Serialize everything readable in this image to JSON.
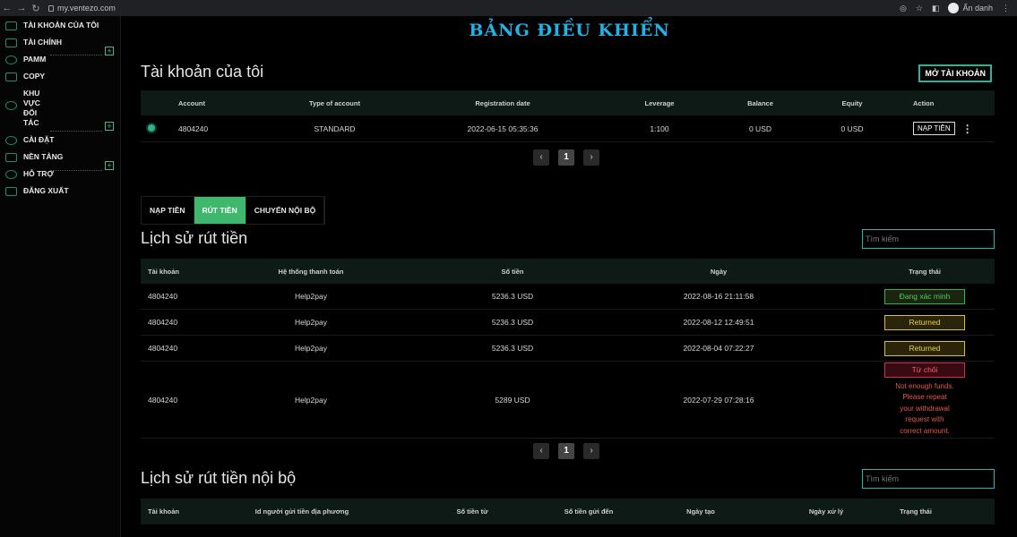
{
  "browser": {
    "url": "my.ventezo.com",
    "profile_label": "Ẩn danh"
  },
  "sidebar": {
    "items": [
      {
        "label": "TÀI KHOẢN CỦA TÔI"
      },
      {
        "label": "TÀI CHÍNH",
        "expandable": true
      },
      {
        "label": "PAMM"
      },
      {
        "label": "COPY"
      },
      {
        "label": "KHU VỰC ĐỐI TÁC",
        "expandable": true
      },
      {
        "label": "CÀI ĐẶT",
        "expandable": true
      },
      {
        "label": "NỀN TẢNG"
      },
      {
        "label": "HỖ TRỢ"
      },
      {
        "label": "ĐĂNG XUẤT"
      }
    ]
  },
  "main": {
    "dashboard_title": "BẢNG ĐIỀU KHIỂN",
    "accounts": {
      "title": "Tài khoản của tôi",
      "open_button": "MỞ TÀI KHOẢN",
      "columns": [
        "Account",
        "Type of account",
        "Registration date",
        "Leverage",
        "Balance",
        "Equity",
        "Action"
      ],
      "rows": [
        {
          "account": "4804240",
          "type": "STANDARD",
          "date": "2022-06-15 05:35:36",
          "leverage": "1:100",
          "balance": "0 USD",
          "equity": "0 USD",
          "action": "NẠP TIỀN"
        }
      ],
      "page": "1"
    },
    "tabs": [
      "NẠP TIỀN",
      "RÚT TIỀN",
      "CHUYỂN NỘI BỘ"
    ],
    "active_tab": "RÚT TIỀN",
    "withdrawals": {
      "title": "Lịch sử rút tiền",
      "search_placeholder": "Tìm kiếm",
      "columns": [
        "Tài khoản",
        "Hệ thống thanh toán",
        "Số tiền",
        "Ngày",
        "Trạng thái"
      ],
      "rows": [
        {
          "account": "4804240",
          "system": "Help2pay",
          "amount": "5236.3 USD",
          "date": "2022-08-16 21:11:58",
          "status": "Đang xác minh",
          "status_type": "verify"
        },
        {
          "account": "4804240",
          "system": "Help2pay",
          "amount": "5236.3 USD",
          "date": "2022-08-12 12:49:51",
          "status": "Returned",
          "status_type": "returned"
        },
        {
          "account": "4804240",
          "system": "Help2pay",
          "amount": "5236.3 USD",
          "date": "2022-08-04 07:22:27",
          "status": "Returned",
          "status_type": "returned"
        },
        {
          "account": "4804240",
          "system": "Help2pay",
          "amount": "5289 USD",
          "date": "2022-07-29 07:28:16",
          "status": "Từ chối",
          "status_type": "reject",
          "note": [
            "Not enough funds.",
            "Please repeat",
            "your withdrawal",
            "request with",
            "correct amount."
          ]
        }
      ],
      "page": "1"
    },
    "internal": {
      "title": "Lịch sử rút tiền nội bộ",
      "search_placeholder": "Tìm kiếm",
      "columns": [
        "Tài khoản",
        "Id người gửi tiền địa phương",
        "Số tiền từ",
        "Số tiền gửi đến",
        "Ngày tạo",
        "Ngày xử lý",
        "Trạng thái"
      ]
    }
  },
  "colors": {
    "accent_green": "#3fb86e",
    "title_blue": "#21b3e6",
    "verify": "#4ed25e",
    "returned": "#e8d248",
    "reject": "#ff5a6e"
  }
}
